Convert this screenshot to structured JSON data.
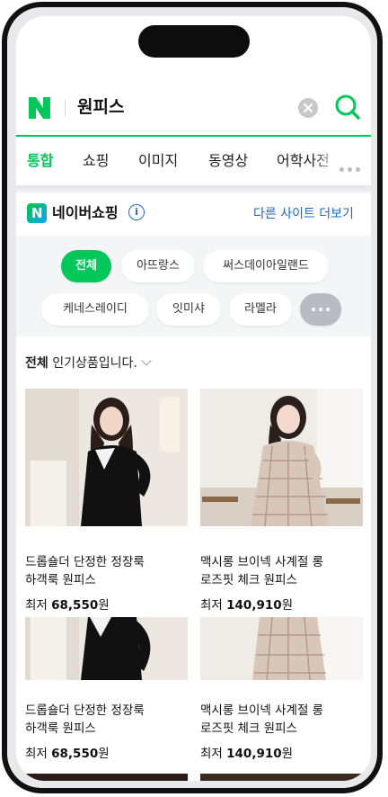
{
  "search": {
    "query": "원피스"
  },
  "tabs": [
    "통합",
    "쇼핑",
    "이미지",
    "동영상",
    "어학사전"
  ],
  "shopping": {
    "title": "네이버쇼핑",
    "other_sites": "다른 사이트 더보기"
  },
  "chips": [
    "전체",
    "아뜨랑스",
    "써스데이아일랜드",
    "케네스레이디",
    "잇미샤",
    "라멜라"
  ],
  "popular": {
    "prefix": "전체",
    "suffix": " 인기상품입니다."
  },
  "products": [
    {
      "name_line1": "드롭숄더 단정한 정장룩",
      "name_line2": "하객룩 원피스",
      "price_label": "최저",
      "price": "68,550",
      "currency": "원"
    },
    {
      "name_line1": "맥시롱 브이넥 사계절 롱",
      "name_line2": "로즈핏 체크 원피스",
      "price_label": "최저",
      "price": "140,910",
      "currency": "원"
    },
    {
      "name_line1": "드롭숄더 단정한 정장룩",
      "name_line2": "하객룩 원피스",
      "price_label": "최저",
      "price": "68,550",
      "currency": "원"
    },
    {
      "name_line1": "맥시롱 브이넥 사계절 롱",
      "name_line2": "로즈핏 체크 원피스",
      "price_label": "최저",
      "price": "140,910",
      "currency": "원"
    }
  ],
  "colors": {
    "accent": "#03c75a",
    "link": "#1a69c9"
  }
}
